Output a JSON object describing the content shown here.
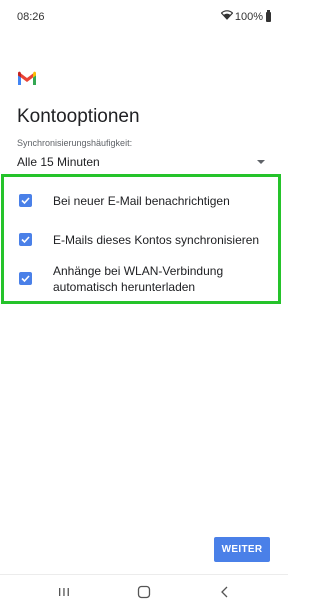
{
  "status": {
    "time": "08:26",
    "battery_text": "100%"
  },
  "title": "Kontooptionen",
  "sync": {
    "label": "Synchronisierungshäufigkeit:",
    "value": "Alle 15 Minuten"
  },
  "options": [
    {
      "label": "Bei neuer E-Mail benachrichtigen",
      "checked": true
    },
    {
      "label": "E-Mails dieses Kontos synchronisieren",
      "checked": true
    },
    {
      "label_line1": "Anhänge bei WLAN-Verbindung",
      "label_line2": "automatisch herunterladen",
      "checked": true
    }
  ],
  "next_button": "WEITER",
  "colors": {
    "accent": "#4a80e8",
    "highlight_border": "#25c32a"
  },
  "icons": [
    "gmail-logo",
    "wifi-icon",
    "battery-icon",
    "recent-apps-icon",
    "home-icon",
    "back-icon",
    "dropdown-caret-icon",
    "checkbox-checked-icon"
  ]
}
